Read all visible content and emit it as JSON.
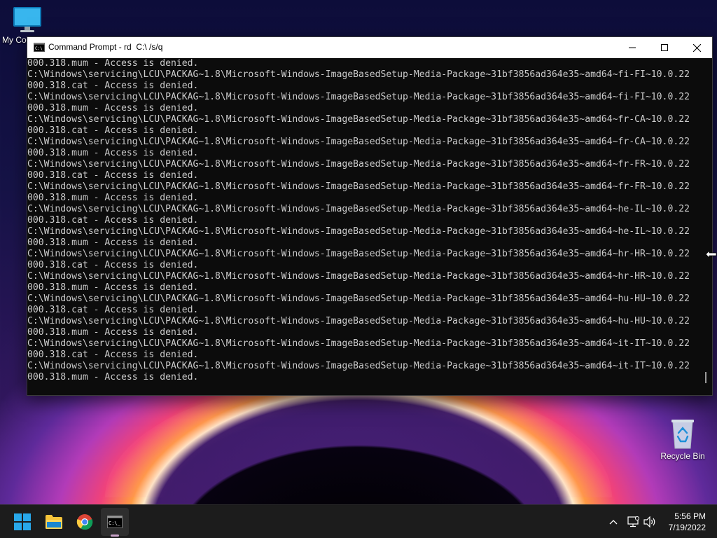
{
  "desktop": {
    "icons": [
      {
        "label": "My Computer",
        "icon": "monitor-icon"
      },
      {
        "label": "Recycle Bin",
        "icon": "recycle-bin-icon"
      }
    ]
  },
  "window": {
    "title": "Command Prompt - rd  C:\\ /s/q",
    "icon": "cmd-icon",
    "controls": {
      "minimize": "minimize-icon",
      "maximize": "maximize-icon",
      "close": "close-icon"
    }
  },
  "console": {
    "lines": [
      "000.318.mum - Access is denied.",
      "C:\\Windows\\servicing\\LCU\\PACKAG~1.8\\Microsoft-Windows-ImageBasedSetup-Media-Package~31bf3856ad364e35~amd64~fi-FI~10.0.22",
      "000.318.cat - Access is denied.",
      "C:\\Windows\\servicing\\LCU\\PACKAG~1.8\\Microsoft-Windows-ImageBasedSetup-Media-Package~31bf3856ad364e35~amd64~fi-FI~10.0.22",
      "000.318.mum - Access is denied.",
      "C:\\Windows\\servicing\\LCU\\PACKAG~1.8\\Microsoft-Windows-ImageBasedSetup-Media-Package~31bf3856ad364e35~amd64~fr-CA~10.0.22",
      "000.318.cat - Access is denied.",
      "C:\\Windows\\servicing\\LCU\\PACKAG~1.8\\Microsoft-Windows-ImageBasedSetup-Media-Package~31bf3856ad364e35~amd64~fr-CA~10.0.22",
      "000.318.mum - Access is denied.",
      "C:\\Windows\\servicing\\LCU\\PACKAG~1.8\\Microsoft-Windows-ImageBasedSetup-Media-Package~31bf3856ad364e35~amd64~fr-FR~10.0.22",
      "000.318.cat - Access is denied.",
      "C:\\Windows\\servicing\\LCU\\PACKAG~1.8\\Microsoft-Windows-ImageBasedSetup-Media-Package~31bf3856ad364e35~amd64~fr-FR~10.0.22",
      "000.318.mum - Access is denied.",
      "C:\\Windows\\servicing\\LCU\\PACKAG~1.8\\Microsoft-Windows-ImageBasedSetup-Media-Package~31bf3856ad364e35~amd64~he-IL~10.0.22",
      "000.318.cat - Access is denied.",
      "C:\\Windows\\servicing\\LCU\\PACKAG~1.8\\Microsoft-Windows-ImageBasedSetup-Media-Package~31bf3856ad364e35~amd64~he-IL~10.0.22",
      "000.318.mum - Access is denied.",
      "C:\\Windows\\servicing\\LCU\\PACKAG~1.8\\Microsoft-Windows-ImageBasedSetup-Media-Package~31bf3856ad364e35~amd64~hr-HR~10.0.22",
      "000.318.cat - Access is denied.",
      "C:\\Windows\\servicing\\LCU\\PACKAG~1.8\\Microsoft-Windows-ImageBasedSetup-Media-Package~31bf3856ad364e35~amd64~hr-HR~10.0.22",
      "000.318.mum - Access is denied.",
      "C:\\Windows\\servicing\\LCU\\PACKAG~1.8\\Microsoft-Windows-ImageBasedSetup-Media-Package~31bf3856ad364e35~amd64~hu-HU~10.0.22",
      "000.318.cat - Access is denied.",
      "C:\\Windows\\servicing\\LCU\\PACKAG~1.8\\Microsoft-Windows-ImageBasedSetup-Media-Package~31bf3856ad364e35~amd64~hu-HU~10.0.22",
      "000.318.mum - Access is denied.",
      "C:\\Windows\\servicing\\LCU\\PACKAG~1.8\\Microsoft-Windows-ImageBasedSetup-Media-Package~31bf3856ad364e35~amd64~it-IT~10.0.22",
      "000.318.cat - Access is denied.",
      "C:\\Windows\\servicing\\LCU\\PACKAG~1.8\\Microsoft-Windows-ImageBasedSetup-Media-Package~31bf3856ad364e35~amd64~it-IT~10.0.22",
      "000.318.mum - Access is denied."
    ]
  },
  "taskbar": {
    "apps": [
      {
        "name": "start",
        "icon": "windows-start-icon"
      },
      {
        "name": "file-explorer",
        "icon": "folder-icon"
      },
      {
        "name": "chrome",
        "icon": "chrome-icon"
      },
      {
        "name": "command-prompt",
        "icon": "cmd-icon",
        "active": true
      }
    ],
    "tray": [
      "chevron-up-icon",
      "network-icon",
      "volume-icon"
    ],
    "clock": {
      "time": "5:56 PM",
      "date": "7/19/2022"
    }
  },
  "colors": {
    "console_bg": "#0c0c0c",
    "console_text": "#cccccc",
    "taskbar_bg": "#1c1c1c",
    "titlebar_bg": "#ffffff"
  }
}
